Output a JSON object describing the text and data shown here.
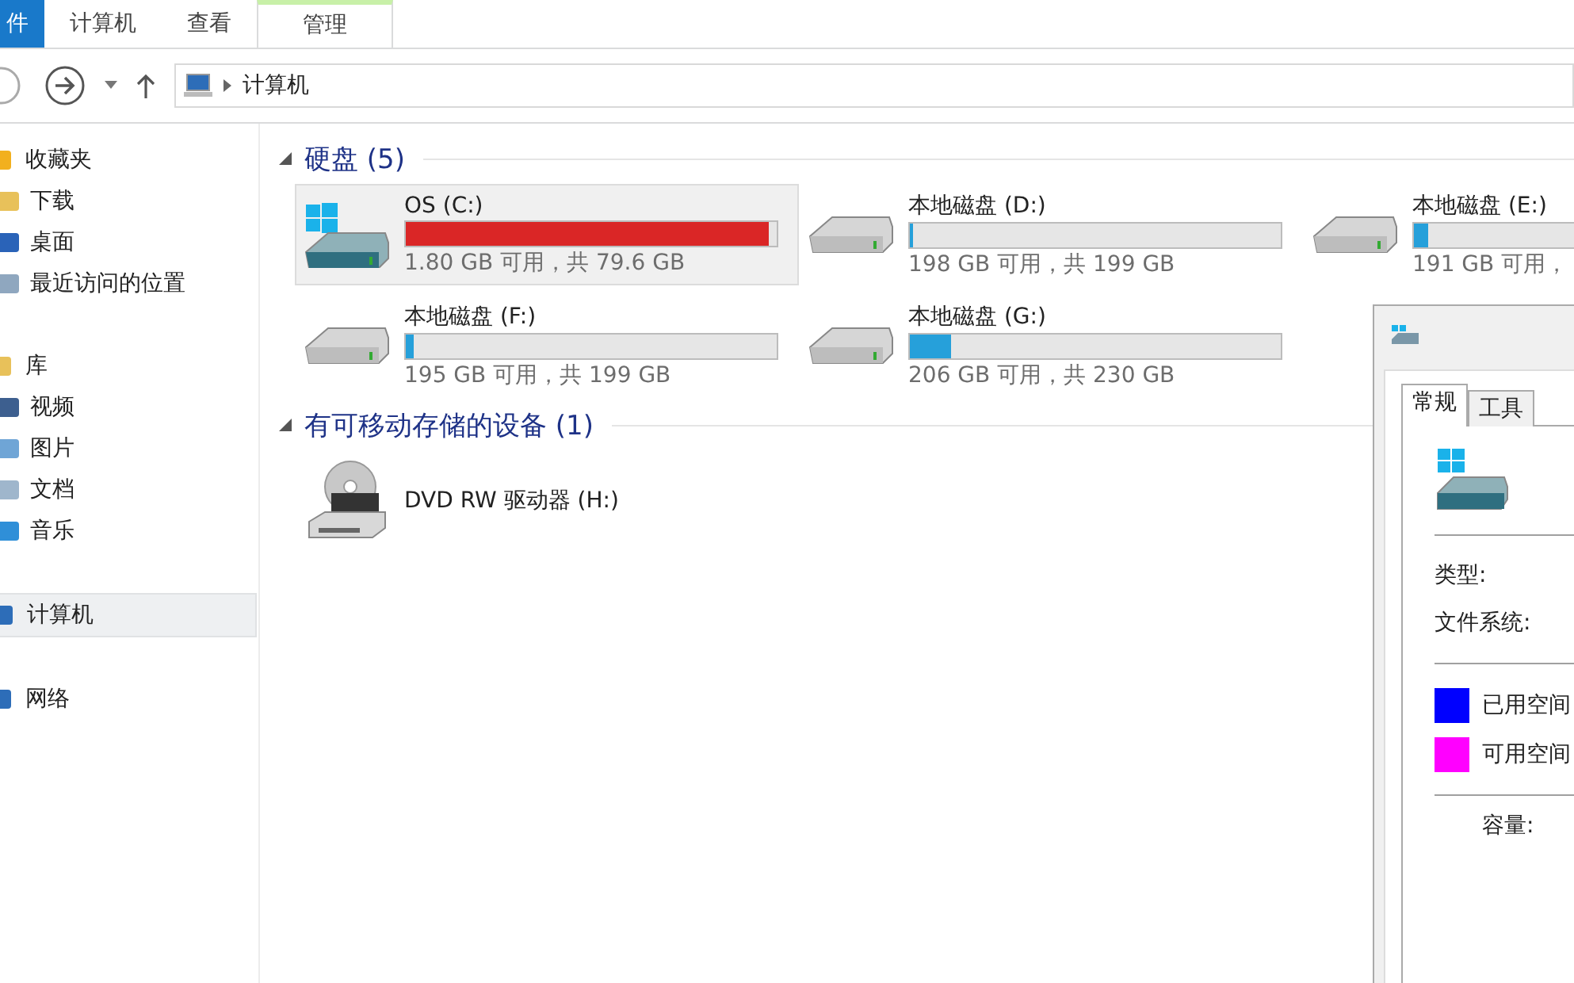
{
  "ribbon_tabs": [
    {
      "label": "件",
      "kind": "file"
    },
    {
      "label": "计算机",
      "kind": "tab"
    },
    {
      "label": "查看",
      "kind": "tab"
    },
    {
      "label": "管理",
      "kind": "context"
    }
  ],
  "address_bar": {
    "path": "计算机"
  },
  "sidebar": {
    "groups": [
      {
        "label": "收藏夹",
        "kind": "star",
        "selected": false,
        "children": [
          {
            "label": "下载",
            "kind": "download",
            "selected": false
          },
          {
            "label": "桌面",
            "kind": "desktop",
            "selected": false
          },
          {
            "label": "最近访问的位置",
            "kind": "recent",
            "selected": false
          }
        ]
      },
      {
        "label": "库",
        "kind": "library",
        "selected": false,
        "children": [
          {
            "label": "视频",
            "kind": "video",
            "selected": false
          },
          {
            "label": "图片",
            "kind": "picture",
            "selected": false
          },
          {
            "label": "文档",
            "kind": "document",
            "selected": false
          },
          {
            "label": "音乐",
            "kind": "music",
            "selected": false
          }
        ]
      },
      {
        "label": "计算机",
        "kind": "computer",
        "selected": true
      },
      {
        "label": "网络",
        "kind": "network",
        "selected": false
      }
    ]
  },
  "sections": [
    {
      "title": "硬盘 (5)",
      "expanded": true,
      "drives": [
        {
          "name": "OS (C:)",
          "kind": "system",
          "selected": true,
          "level": 0.977,
          "color": "#da2626",
          "info": "1.80 GB 可用，共 79.6 GB"
        },
        {
          "name": "本地磁盘 (D:)",
          "kind": "disk",
          "selected": false,
          "level": 0.01,
          "color": "#26a0da",
          "info": "198 GB 可用，共 199 GB"
        },
        {
          "name": "本地磁盘 (E:)",
          "kind": "disk",
          "selected": false,
          "level": 0.04,
          "color": "#26a0da",
          "info": "191 GB 可用，"
        },
        {
          "name": "本地磁盘 (F:)",
          "kind": "disk",
          "selected": false,
          "level": 0.02,
          "color": "#26a0da",
          "info": "195 GB 可用，共 199 GB"
        },
        {
          "name": "本地磁盘 (G:)",
          "kind": "disk",
          "selected": false,
          "level": 0.11,
          "color": "#26a0da",
          "info": "206 GB 可用，共 230 GB"
        }
      ]
    },
    {
      "title": "有可移动存储的设备 (1)",
      "expanded": true,
      "drives": [
        {
          "name": "DVD RW 驱动器 (H:)",
          "kind": "dvd",
          "selected": false
        }
      ]
    }
  ],
  "properties_dialog": {
    "tabs": [
      {
        "label": "常规",
        "selected": true
      },
      {
        "label": "工具",
        "selected": false
      }
    ],
    "fields": [
      "类型:",
      "文件系统:"
    ],
    "legend": [
      {
        "label": "已用空间",
        "color": "#0000ff"
      },
      {
        "label": "可用空间",
        "color": "#ff00ff"
      }
    ],
    "capacity_label": "容量:"
  }
}
